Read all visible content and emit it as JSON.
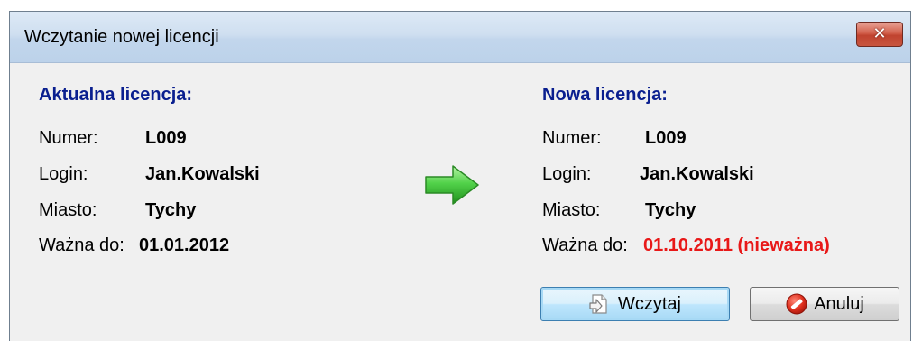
{
  "window": {
    "title": "Wczytanie nowej licencji",
    "close_icon": "close-icon"
  },
  "current_license": {
    "heading": "Aktualna licencja:",
    "number_label": "Numer:",
    "number_value": "L009",
    "login_label": "Login:",
    "login_value": "Jan.Kowalski",
    "city_label": "Miasto:",
    "city_value": "Tychy",
    "valid_label": "Ważna do:",
    "valid_value": "01.01.2012"
  },
  "new_license": {
    "heading": "Nowa licencja:",
    "number_label": "Numer:",
    "number_value": "L009",
    "login_label": "Login:",
    "login_value": "Jan.Kowalski",
    "city_label": "Miasto:",
    "city_value": "Tychy",
    "valid_label": "Ważna do:",
    "valid_value": "01.10.2011 (nieważna)"
  },
  "arrow_icon": "green-arrow-right-icon",
  "buttons": {
    "load_label": "Wczytaj",
    "load_icon": "import-icon",
    "cancel_label": "Anuluj",
    "cancel_icon": "cancel-icon"
  },
  "colors": {
    "heading": "#0a1f8f",
    "invalid": "#e81818",
    "arrow": "#3fc23a"
  }
}
